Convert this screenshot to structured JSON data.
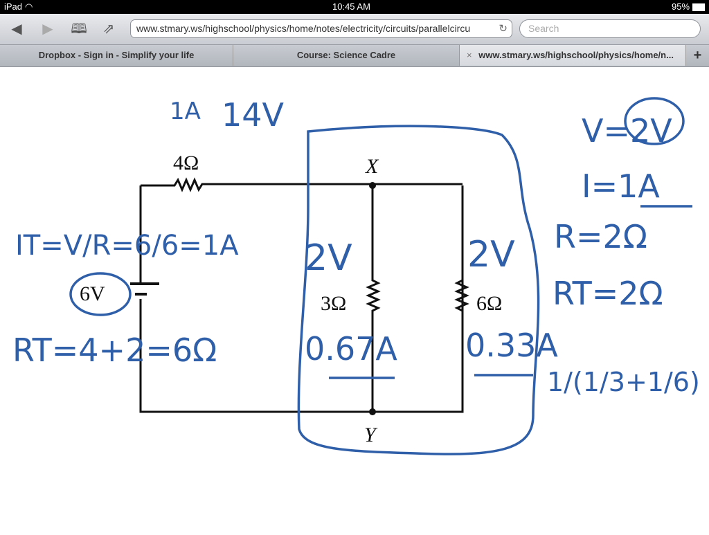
{
  "status_bar": {
    "device": "iPad",
    "time": "10:45 AM",
    "battery": "95%"
  },
  "toolbar": {
    "back_icon": "back-arrow-icon",
    "forward_icon": "forward-arrow-icon",
    "bookmarks_icon": "book-icon",
    "share_icon": "share-icon",
    "url": "www.stmary.ws/highschool/physics/home/notes/electricity/circuits/parallelcircu",
    "search_placeholder": "Search"
  },
  "tabs": [
    {
      "label": "Dropbox - Sign in - Simplify your life",
      "active": false
    },
    {
      "label": "Course: Science Cadre",
      "active": false
    },
    {
      "label": "www.stmary.ws/highschool/physics/home/n...",
      "active": true,
      "close": "×"
    }
  ],
  "new_tab": "+",
  "circuit": {
    "r1": "4Ω",
    "r2": "3Ω",
    "r3": "6Ω",
    "battery": "6V",
    "node_top": "X",
    "node_bottom": "Y"
  },
  "handwriting": {
    "color": "#2f5fa8",
    "top_note1": "1A",
    "top_note2": "14V",
    "v": "V=2V",
    "i": "I=1A",
    "r": "R=2Ω",
    "rt_right": "RT=2Ω",
    "it": "IT=V/R=6/6=1A",
    "rt_left": "RT=4+2=6Ω",
    "v_mid": "2V",
    "v_right": "2V",
    "i_mid": "0.67A",
    "i_right": "0.33A",
    "formula": "1/(1/3+1/6)"
  }
}
